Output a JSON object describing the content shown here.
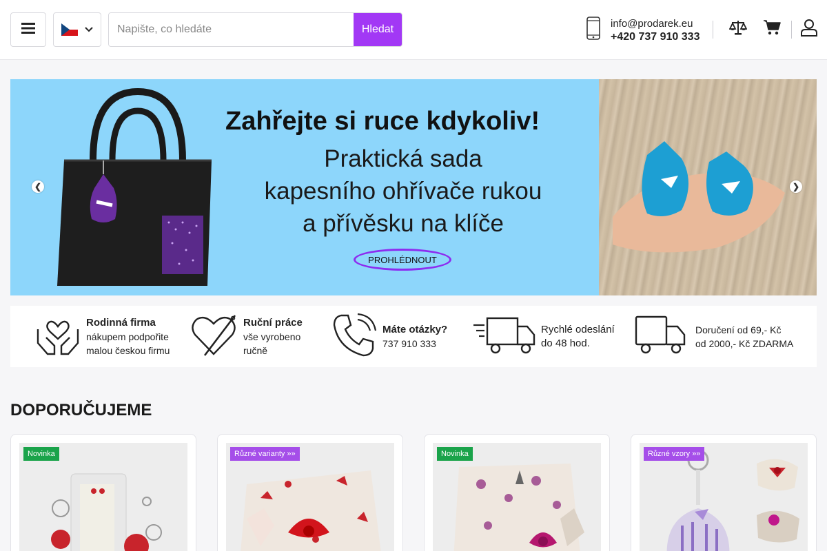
{
  "header": {
    "search": {
      "placeholder": "Napište, co hledáte",
      "button_label": "Hledat"
    },
    "contact": {
      "email": "info@prodarek.eu",
      "phone": "+420 737 910 333"
    },
    "icons": [
      "menu-icon",
      "czech-flag-icon",
      "chevron-down-icon",
      "smartphone-icon",
      "scales-compare-icon",
      "cart-icon",
      "user-icon"
    ]
  },
  "banner": {
    "title": "Zahřejte si ruce kdykoliv!",
    "subtitle_lines": [
      "Praktická sada",
      "kapesního ohřívače rukou",
      "a přívěsku na klíče"
    ],
    "cta_label": "PROHLÉDNOUT"
  },
  "features": [
    {
      "icon": "caring-hands-icon",
      "title": "Rodinná firma",
      "lines": [
        "nákupem podpořite",
        "malou českou firmu"
      ]
    },
    {
      "icon": "heart-needle-icon",
      "title": "Ruční práce",
      "lines": [
        "vše vyrobeno",
        "ručně"
      ]
    },
    {
      "icon": "phone-icon",
      "title": "Máte otázky?",
      "lines": [
        "737 910 333"
      ]
    },
    {
      "icon": "fast-truck-icon",
      "title": "",
      "lines": [
        "Rychlé odeslání",
        "do 48 hod."
      ]
    },
    {
      "icon": "truck-icon",
      "title": "",
      "lines": [
        "Doručení od 69,- Kč",
        "od 2000,- Kč ZDARMA"
      ]
    }
  ],
  "section": {
    "title": "DOPORUČUJEME"
  },
  "products": [
    {
      "badge": "Novinka",
      "badge_color": "#1aa34a"
    },
    {
      "badge": "Různé varianty »»",
      "badge_color": "#a54ee9"
    },
    {
      "badge": "Novinka",
      "badge_color": "#1aa34a"
    },
    {
      "badge": "Různé vzory »»",
      "badge_color": "#a54ee9"
    }
  ],
  "colors": {
    "accent": "#a238f5",
    "banner_bg": "#8dd6fb",
    "badge_new": "#1aa34a",
    "badge_variant": "#a54ee9"
  }
}
